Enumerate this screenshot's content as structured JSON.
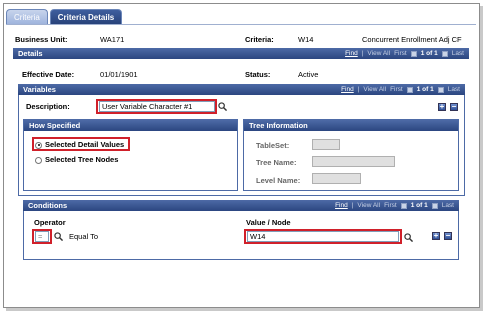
{
  "tabs": [
    {
      "label": "Criteria",
      "active": false
    },
    {
      "label": "Criteria Details",
      "active": true
    }
  ],
  "header": {
    "business_unit_label": "Business Unit:",
    "business_unit_value": "WA171",
    "criteria_label": "Criteria:",
    "criteria_value": "W14",
    "criteria_desc": "Concurrent Enrollment Adj CF"
  },
  "details": {
    "title": "Details",
    "nav": {
      "find": "Find",
      "view_all": "View All",
      "first": "First",
      "count": "1 of 1",
      "last": "Last"
    },
    "effective_date_label": "Effective Date:",
    "effective_date_value": "01/01/1901",
    "status_label": "Status:",
    "status_value": "Active"
  },
  "variables": {
    "title": "Variables",
    "nav": {
      "find": "Find",
      "view_all": "View All",
      "first": "First",
      "count": "1 of 1",
      "last": "Last"
    },
    "description_label": "Description:",
    "description_value": "User Variable Character #1",
    "how_specified": {
      "title": "How Specified",
      "option1": "Selected Detail Values",
      "option2": "Selected Tree Nodes",
      "selected": "option1"
    },
    "tree_info": {
      "title": "Tree Information",
      "tableset_label": "TableSet:",
      "tree_name_label": "Tree Name:",
      "level_name_label": "Level Name:"
    }
  },
  "conditions": {
    "title": "Conditions",
    "nav": {
      "find": "Find",
      "view_all": "View All",
      "first": "First",
      "count": "1 of 1",
      "last": "Last"
    },
    "operator_label": "Operator",
    "operator_value": "=",
    "operator_desc": "Equal To",
    "value_node_label": "Value / Node",
    "value_node_value": "W14"
  },
  "buttons": {
    "add": "+",
    "remove": "−"
  },
  "colors": {
    "accent": "#2b4680",
    "highlight": "#d0202a"
  }
}
